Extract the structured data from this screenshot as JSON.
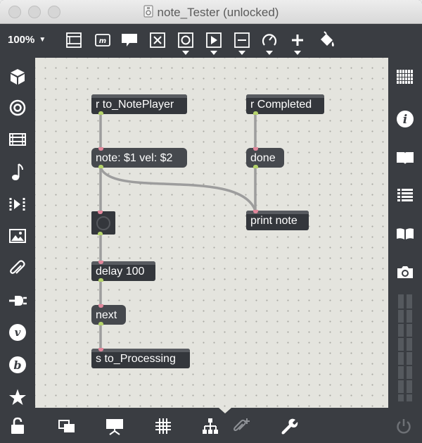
{
  "window": {
    "title": "note_Tester (unlocked)"
  },
  "toolbar": {
    "zoom_label": "100%",
    "zoom_caret": "▼"
  },
  "patch": {
    "objects": {
      "receive_noteplayer": "r to_NotePlayer",
      "receive_completed": "r Completed",
      "note_message": "note: $1 vel: $2",
      "done_message": "done",
      "print_note": "print note",
      "delay": "delay 100",
      "next_message": "next",
      "send_processing": "s to_Processing"
    }
  },
  "colors": {
    "toolbar_bg": "#3a3d42",
    "canvas_bg": "#e4e4de",
    "object_bg": "#34373c",
    "inlet": "#e1879b",
    "outlet": "#b5d36b",
    "cord": "#9d9d9d"
  },
  "icons": {
    "toolbar": [
      "presentation-icon",
      "comment-m-icon",
      "speech-bubble-icon",
      "toggle-x-icon",
      "button-icon",
      "play-icon",
      "slider-icon",
      "dial-icon",
      "plus-icon",
      "paint-bucket-icon"
    ],
    "left": [
      "cube-icon",
      "target-icon",
      "film-icon",
      "note-icon",
      "sequencer-icon",
      "image-icon",
      "paperclip-icon",
      "plug-icon",
      "vizzie-icon",
      "beap-icon",
      "star-icon"
    ],
    "right": [
      "grid-keyboard-icon",
      "info-icon",
      "book-open-icon",
      "list-icon",
      "reference-book-icon",
      "camera-icon",
      "meter-icon"
    ],
    "bottom": [
      "lock-icon",
      "windows-icon",
      "presentation-screen-icon",
      "grid-icon",
      "hierarchy-icon",
      "paperclip-add-icon",
      "wrench-icon",
      "power-icon"
    ]
  }
}
